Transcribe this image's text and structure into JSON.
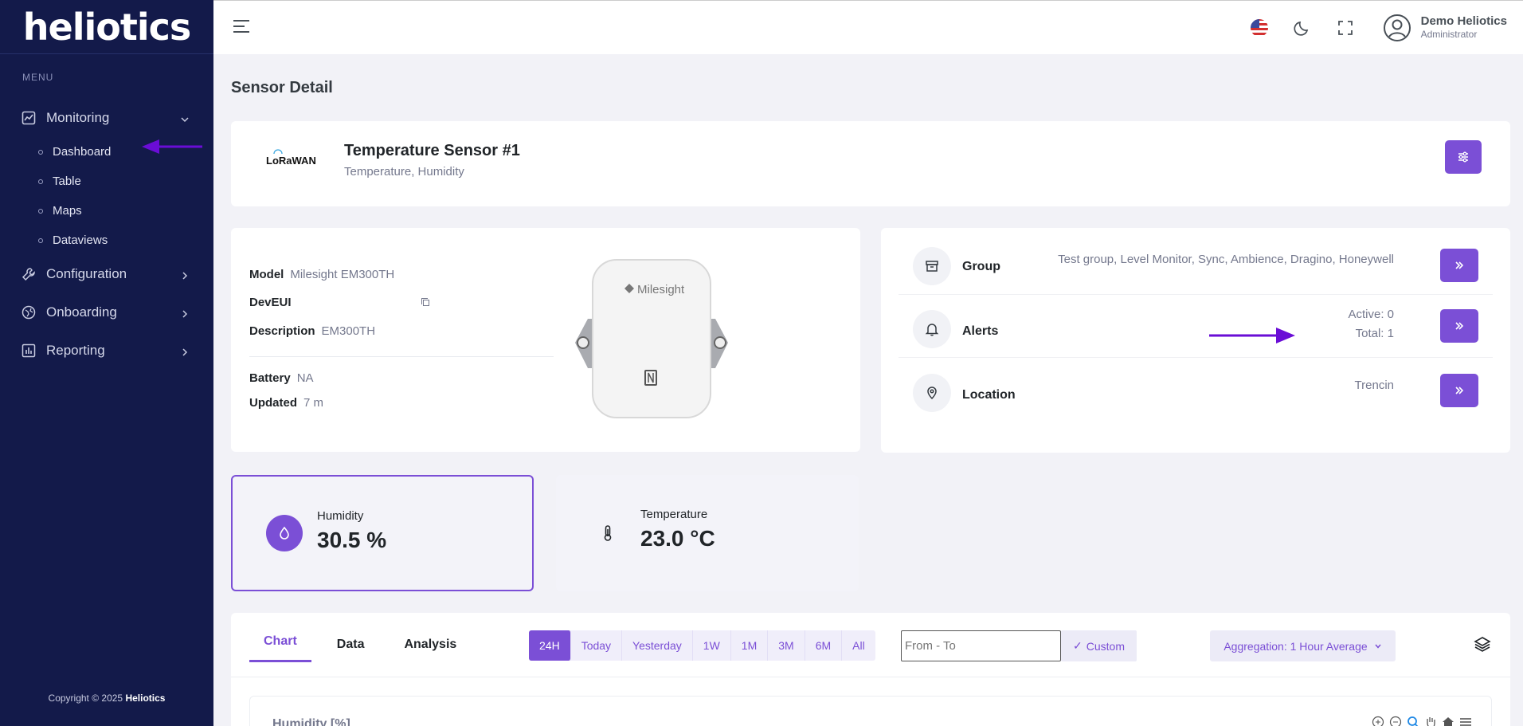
{
  "app": {
    "logo": "heliotics"
  },
  "sidebar": {
    "menu_title": "MENU",
    "monitoring": "Monitoring",
    "sub_items": [
      "Dashboard",
      "Table",
      "Maps",
      "Dataviews"
    ],
    "configuration": "Configuration",
    "onboarding": "Onboarding",
    "reporting": "Reporting",
    "copyright_prefix": "Copyright © 2025",
    "copyright_brand": "Heliotics"
  },
  "topbar": {
    "user_name": "Demo Heliotics",
    "user_role": "Administrator"
  },
  "page": {
    "title": "Sensor Detail"
  },
  "sensor": {
    "protocol_logo": "LoRaWAN",
    "name": "Temperature Sensor #1",
    "types": "Temperature, Humidity"
  },
  "info": {
    "model_label": "Model",
    "model": "Milesight EM300TH",
    "deveui_label": "DevEUI",
    "deveui": "",
    "description_label": "Description",
    "description": "EM300TH",
    "battery_label": "Battery",
    "battery": "NA",
    "updated_label": "Updated",
    "updated": "7 m",
    "device_brand": "Milesight"
  },
  "side": {
    "group_label": "Group",
    "group_value": "Test group, Level Monitor, Sync, Ambience, Dragino, Honeywell",
    "alerts_label": "Alerts",
    "alerts_active": "Active: 0",
    "alerts_total": "Total: 1",
    "location_label": "Location",
    "location_value": "Trencin"
  },
  "metrics": {
    "humidity_label": "Humidity",
    "humidity_value": "30.5 %",
    "temperature_label": "Temperature",
    "temperature_value": "23.0 °C"
  },
  "chart_panel": {
    "tabs": [
      "Chart",
      "Data",
      "Analysis"
    ],
    "ranges": [
      "24H",
      "Today",
      "Yesterday",
      "1W",
      "1M",
      "3M",
      "6M",
      "All"
    ],
    "from_to_placeholder": "From - To",
    "custom": "Custom",
    "aggregation": "Aggregation: 1 Hour Average",
    "chart_title": "Humidity [%]"
  },
  "colors": {
    "accent": "#7b4fd6",
    "sidebar": "#131a4a"
  }
}
